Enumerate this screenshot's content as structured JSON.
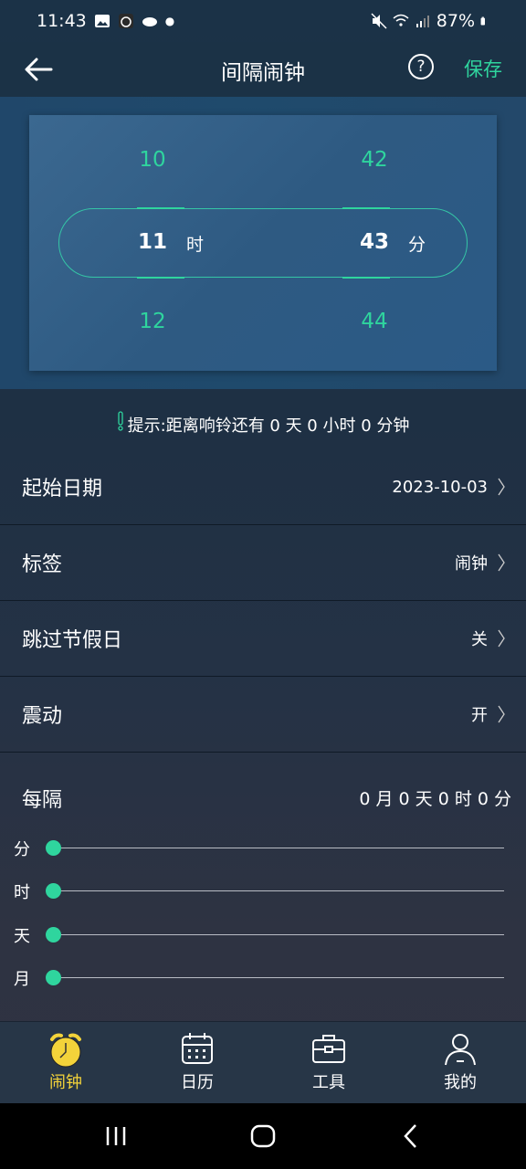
{
  "status_bar": {
    "time": "11:43",
    "battery": "87%"
  },
  "header": {
    "title": "间隔闹钟",
    "help_label": "?",
    "save_label": "保存"
  },
  "picker": {
    "hours": {
      "prev": "10",
      "current": "11",
      "next": "12",
      "unit": "时"
    },
    "minutes": {
      "prev": "42",
      "current": "43",
      "next": "44",
      "unit": "分"
    }
  },
  "hint": {
    "text": "提示:距离响铃还有 0 天 0 小时 0 分钟"
  },
  "rows": [
    {
      "label": "起始日期",
      "value": "2023-10-03"
    },
    {
      "label": "标签",
      "value": "闹钟"
    },
    {
      "label": "跳过节假日",
      "value": "关"
    },
    {
      "label": "震动",
      "value": "开"
    }
  ],
  "interval": {
    "label": "每隔",
    "value": "0 月 0 天 0 时 0 分",
    "sliders": [
      {
        "label": "分",
        "level": 0
      },
      {
        "label": "时",
        "level": 0
      },
      {
        "label": "天",
        "level": 0
      },
      {
        "label": "月",
        "level": 0
      }
    ]
  },
  "bottom_nav": [
    {
      "label": "闹钟",
      "icon": "alarm-clock-icon",
      "active": true
    },
    {
      "label": "日历",
      "icon": "calendar-icon",
      "active": false
    },
    {
      "label": "工具",
      "icon": "toolbox-icon",
      "active": false
    },
    {
      "label": "我的",
      "icon": "person-icon",
      "active": false
    }
  ],
  "colors": {
    "accent": "#2fd59e",
    "active_tab": "#f3d33a"
  }
}
